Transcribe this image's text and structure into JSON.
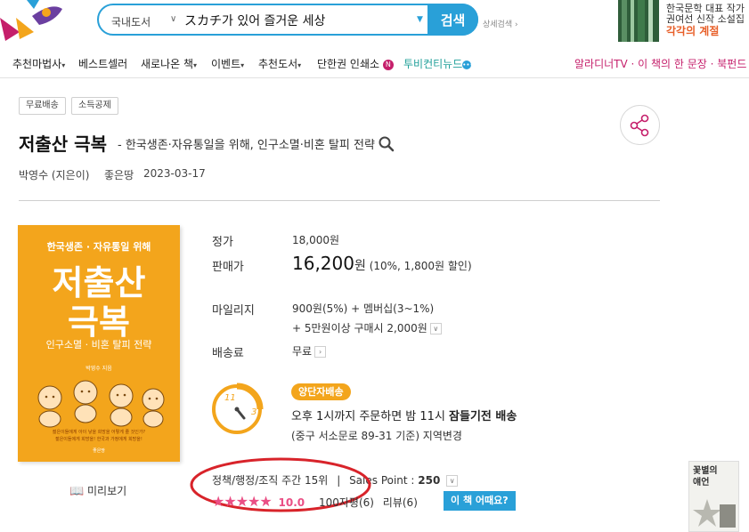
{
  "header": {
    "search": {
      "category": "국내도서",
      "query": "スカチ가 있어 즐거운 세상",
      "button": "검색",
      "detail_link": "상세검색 ›"
    },
    "ad": {
      "line1": "한국문학 대표 작가",
      "line2": "권여선 신작 소설집",
      "line3": "각각의 계절"
    }
  },
  "nav": {
    "items": [
      "추천마법사",
      "베스트셀러",
      "새로나온 책",
      "이벤트",
      "추천도서",
      "단한권 인쇄소",
      "투비컨티뉴드"
    ],
    "badge_n": "N",
    "right": "알라디너TV · 이 책의 한 문장 · 북펀드"
  },
  "book": {
    "tags": [
      "무료배송",
      "소득공제"
    ],
    "title": "저출산 극복",
    "subtitle": "- 한국생존·자유통일을 위해, 인구소멸·비혼 탈피 전략",
    "author": "박영수 (지은이)",
    "publisher": "좋은땅",
    "date": "2023-03-17",
    "cover": {
      "top": "한국생존 · 자유통일 위해",
      "line1": "저출산",
      "line2": "극복",
      "sub": "인구소멸 · 비혼 탈피 전략",
      "author": "박영수 지음",
      "blurb1": "젊은이들에게 아이 낳을 희망을 어떻게 줄 것인가?",
      "blurb2": "젊은이들에게 희망을! 한국과 가정에게 희망을!",
      "publisher": "좋은땅"
    },
    "preview": "미리보기"
  },
  "price": {
    "list_label": "정가",
    "list_value": "18,000원",
    "sale_label": "판매가",
    "sale_value": "16,200",
    "sale_unit": "원",
    "discount": "(10%, 1,800원 할인)",
    "mileage_label": "마일리지",
    "mileage_line1": "900원(5%) + 멤버십(3~1%)",
    "mileage_line2": "+ 5만원이상 구매시 2,000원",
    "ship_label": "배송료",
    "ship_value": "무료"
  },
  "shipping": {
    "tag": "양단자배송",
    "line1_prefix": "오후 1시까지 주문하면 밤 11시",
    "line1_bold": "잠들기전 배송",
    "line2": "(중구 서소문로 89-31 기준) 지역변경",
    "clock_11": "11",
    "clock_3": "3"
  },
  "stats": {
    "rank": "정책/행정/조직 주간 15위",
    "sales_point_label": "Sales Point :",
    "sales_point_value": "250",
    "score": "10.0",
    "comments": "100자평(6)",
    "reviews": "리뷰(6)",
    "ask_button": "이 책 어때요?"
  },
  "side": {
    "book_title": "꽃별의 얘언"
  },
  "colors": {
    "accent_blue": "#29a0d8",
    "pink": "#c51f6b",
    "cover_orange": "#f3a51c",
    "star_pink": "#ea4f85",
    "highlight_red": "#d8232a"
  }
}
